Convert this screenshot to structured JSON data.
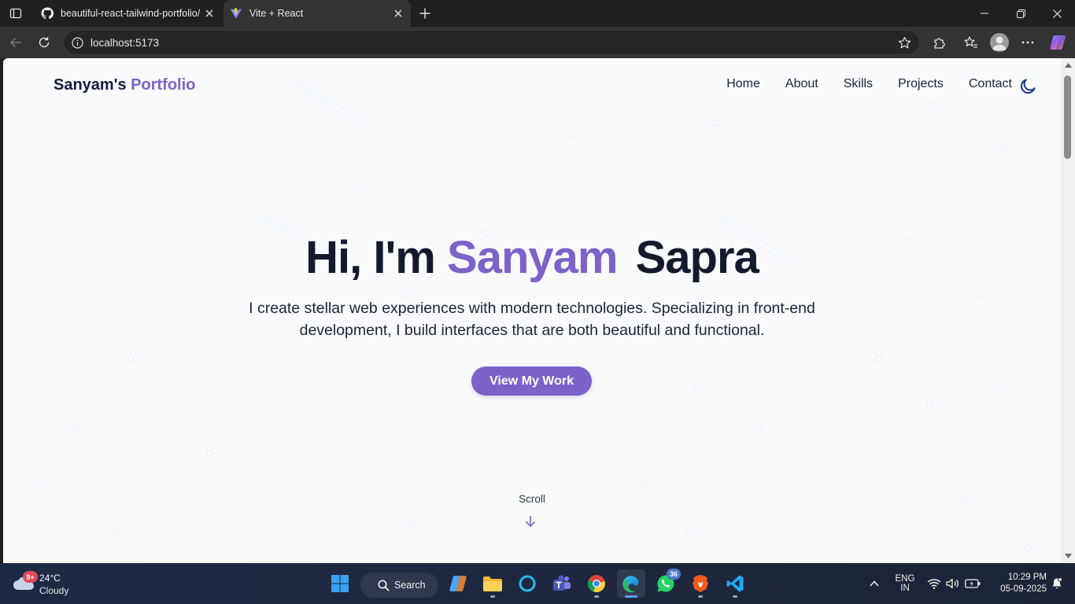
{
  "browser": {
    "tabs": [
      {
        "title": "beautiful-react-tailwind-portfolio/",
        "favicon": "github-icon",
        "active": false
      },
      {
        "title": "Vite + React",
        "favicon": "vite-icon",
        "active": true
      }
    ],
    "url": "localhost:5173"
  },
  "page": {
    "logo": {
      "part1": "Sanyam's",
      "part2": "Portfolio"
    },
    "nav": [
      "Home",
      "About",
      "Skills",
      "Projects",
      "Contact"
    ],
    "hero": {
      "greeting": "Hi, I'm",
      "first_name": "Sanyam",
      "last_name": "Sapra",
      "subtitle": "I create stellar web experiences with modern technologies. Specializing in front-end development, I build interfaces that are both beautiful and functional.",
      "cta": "View My Work"
    },
    "scroll_label": "Scroll",
    "colors": {
      "accent": "#7c62c9",
      "text": "#131a2c",
      "background": "#f8fafc"
    }
  },
  "taskbar": {
    "weather": {
      "temp": "24°C",
      "condition": "Cloudy",
      "badge": "9+"
    },
    "search_label": "Search",
    "whatsapp_badge": "36",
    "lang_top": "ENG",
    "lang_bottom": "IN",
    "time": "10:29 PM",
    "date": "05-09-2025"
  }
}
